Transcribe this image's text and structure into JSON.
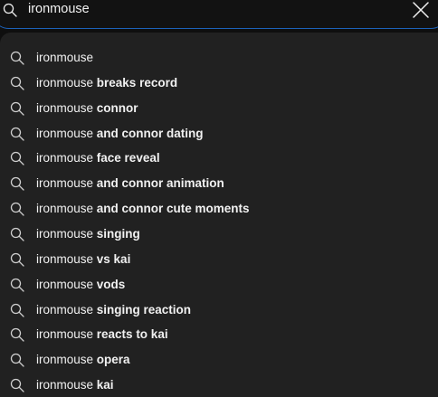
{
  "search": {
    "value": "ironmouse",
    "accent_color": "#1c62b9"
  },
  "icons": {
    "search": "search-icon",
    "clear": "close-icon"
  },
  "suggestions": [
    {
      "query": "ironmouse",
      "completion": ""
    },
    {
      "query": "ironmouse",
      "completion": " breaks record"
    },
    {
      "query": "ironmouse",
      "completion": " connor"
    },
    {
      "query": "ironmouse",
      "completion": " and connor dating"
    },
    {
      "query": "ironmouse",
      "completion": " face reveal"
    },
    {
      "query": "ironmouse",
      "completion": " and connor animation"
    },
    {
      "query": "ironmouse",
      "completion": " and connor cute moments"
    },
    {
      "query": "ironmouse",
      "completion": " singing"
    },
    {
      "query": "ironmouse",
      "completion": " vs kai"
    },
    {
      "query": "ironmouse",
      "completion": " vods"
    },
    {
      "query": "ironmouse",
      "completion": " singing reaction"
    },
    {
      "query": "ironmouse",
      "completion": " reacts to kai"
    },
    {
      "query": "ironmouse",
      "completion": " opera"
    },
    {
      "query": "ironmouse",
      "completion": " kai"
    }
  ]
}
